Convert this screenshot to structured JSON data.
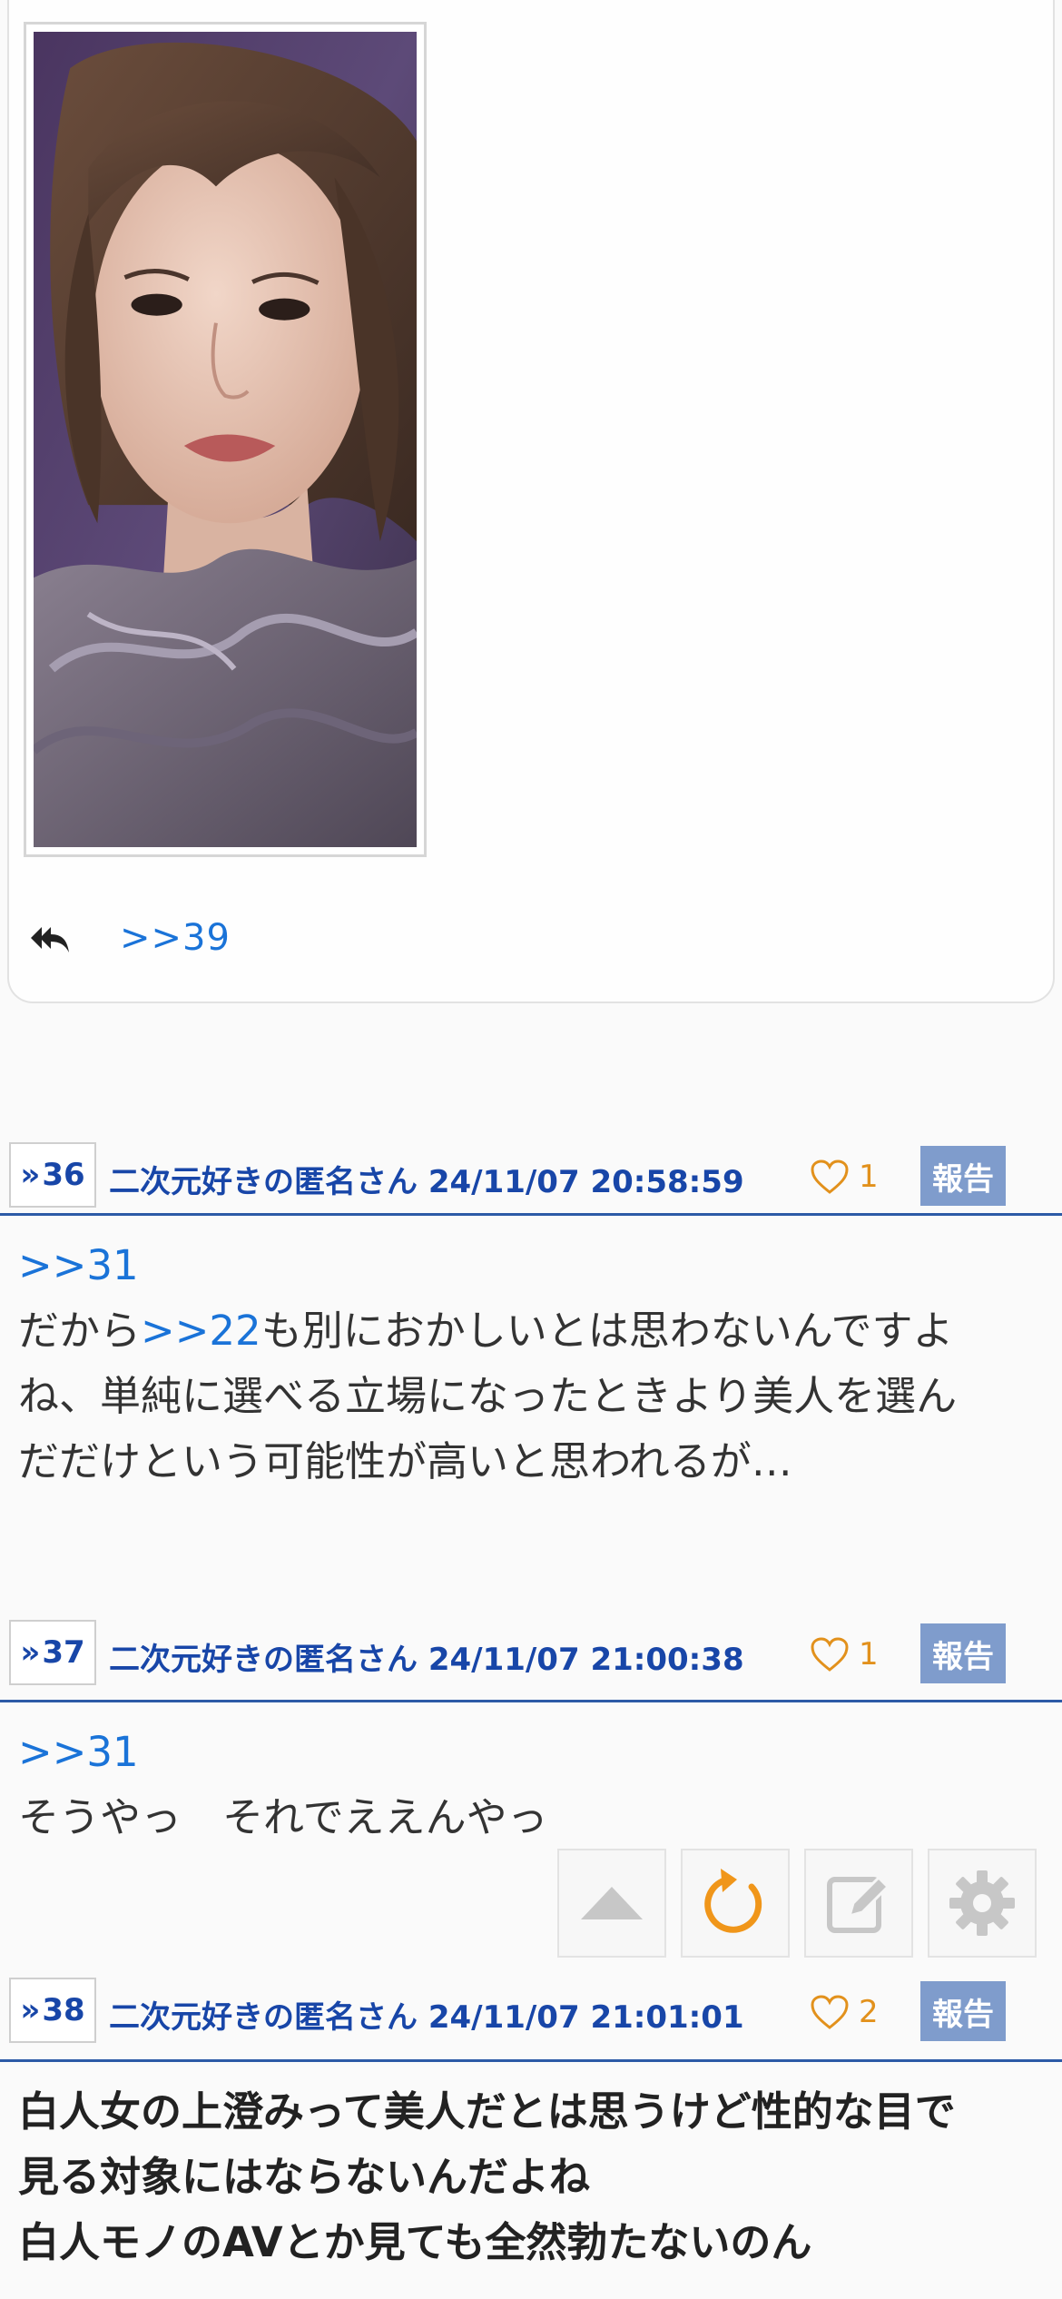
{
  "quoted_card": {
    "image_alt": "woman portrait photo",
    "reply_link": ">>39"
  },
  "posts": [
    {
      "number": "36",
      "author": "二次元好きの匿名さん",
      "datetime": "24/11/07 20:58:59",
      "likes": "1",
      "report_label": "報告",
      "reply_anchor": ">>31",
      "lines": [
        {
          "prefix": "だから",
          "anchor": ">>22",
          "suffix": "も別におかしいとは思わないんですよ"
        },
        {
          "text": "ね、単純に選べる立場になったときより美人を選ん"
        },
        {
          "text": "だだけという可能性が高いと思われるが…"
        }
      ]
    },
    {
      "number": "37",
      "author": "二次元好きの匿名さん",
      "datetime": "24/11/07 21:00:38",
      "likes": "1",
      "report_label": "報告",
      "reply_anchor": ">>31",
      "lines": [
        {
          "text": "そうやっ　それでええんやっ"
        }
      ]
    },
    {
      "number": "38",
      "author": "二次元好きの匿名さん",
      "datetime": "24/11/07 21:01:01",
      "likes": "2",
      "report_label": "報告",
      "lines": [
        {
          "text": "白人女の上澄みって美人だとは思うけど性的な目で"
        },
        {
          "text": "見る対象にはならないんだよね"
        },
        {
          "text": "白人モノのAVとか見ても全然勃たないのん"
        }
      ]
    }
  ],
  "toolbar": {
    "buttons": [
      {
        "icon": "scroll-top-icon"
      },
      {
        "icon": "refresh-icon"
      },
      {
        "icon": "edit-icon"
      },
      {
        "icon": "gear-icon"
      }
    ]
  },
  "colors": {
    "link_blue": "#1a73d8",
    "header_blue": "#1846a8",
    "divider_blue": "#2c5aa6",
    "like_orange": "#e2911c",
    "report_bg": "#7f9ccc"
  }
}
